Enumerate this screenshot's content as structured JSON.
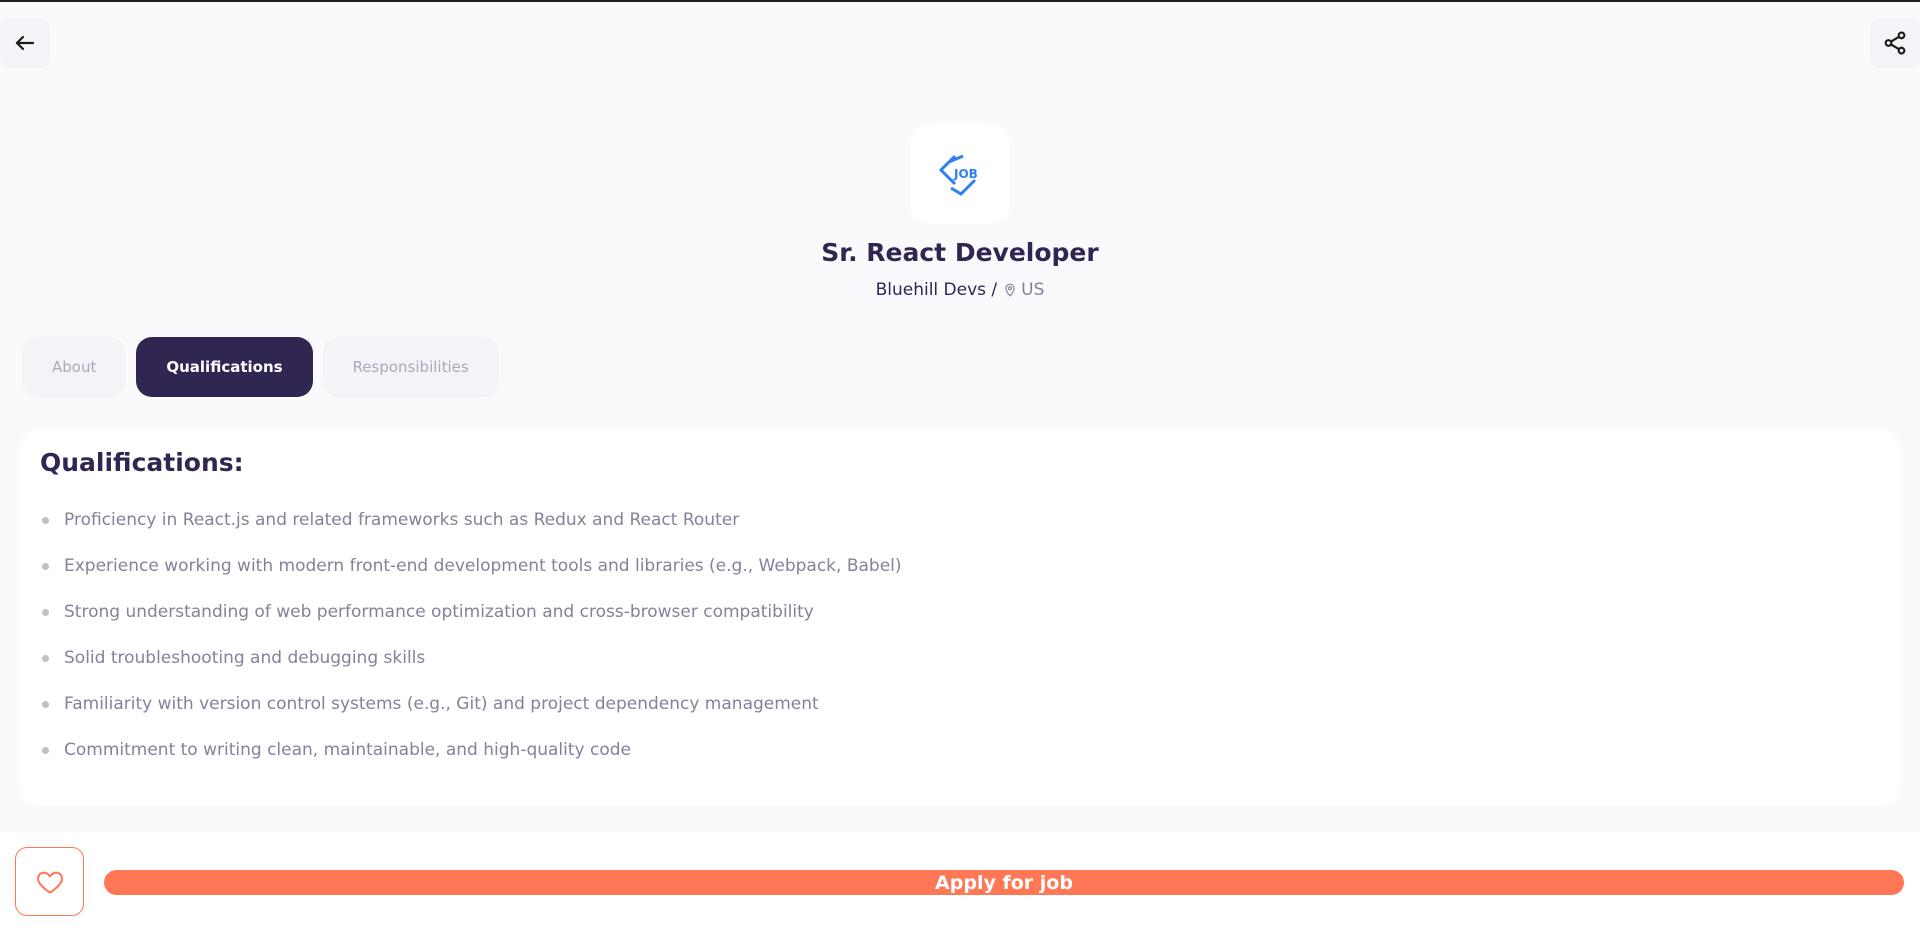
{
  "header": {
    "back_icon": "arrow-left-icon",
    "share_icon": "share-icon"
  },
  "job": {
    "logo_text": "JOB",
    "title": "Sr. React Developer",
    "company": "Bluehill Devs /",
    "location": "US"
  },
  "tabs": [
    {
      "label": "About",
      "active": false
    },
    {
      "label": "Qualifications",
      "active": true
    },
    {
      "label": "Responsibilities",
      "active": false
    }
  ],
  "qualifications": {
    "heading": "Qualifications:",
    "items": [
      "Proficiency in React.js and related frameworks such as Redux and React Router",
      "Experience working with modern front-end development tools and libraries (e.g., Webpack, Babel)",
      "Strong understanding of web performance optimization and cross-browser compatibility",
      "Solid troubleshooting and debugging skills",
      "Familiarity with version control systems (e.g., Git) and project dependency management",
      "Commitment to writing clean, maintainable, and high-quality code"
    ]
  },
  "footer": {
    "like_icon": "heart-outline-icon",
    "apply_label": "Apply for job"
  },
  "colors": {
    "primary": "#312651",
    "accent": "#ff7754",
    "gray": "#83829a",
    "logo_blue": "#2f80ed"
  }
}
